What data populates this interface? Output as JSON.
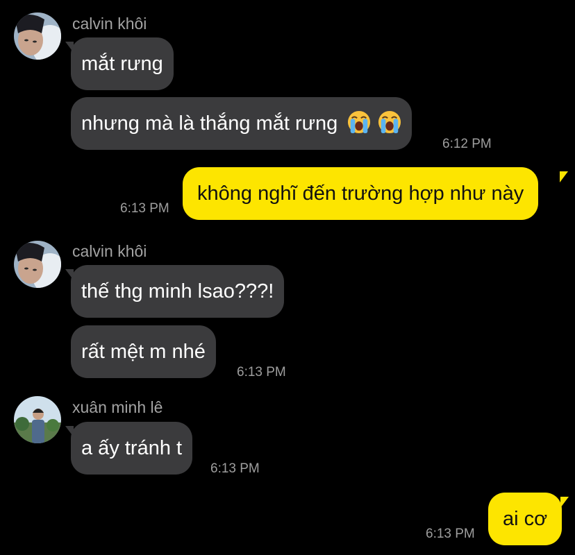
{
  "messages": [
    {
      "sender": "calvin khôi",
      "avatar_icon": "profile-photo-calvin-khoi",
      "bubbles": [
        "mắt rưng",
        "nhưng mà là thắng mắt rưng"
      ],
      "emoji": [
        "loudly-crying-face-emoji",
        "loudly-crying-face-emoji"
      ],
      "time": "6:12 PM"
    },
    {
      "from_me": true,
      "bubbles": [
        "không nghĩ đến trường hợp như này"
      ],
      "time": "6:13 PM"
    },
    {
      "sender": "calvin khôi",
      "avatar_icon": "profile-photo-calvin-khoi",
      "bubbles": [
        "thế thg minh lsao???!",
        "rất mệt m nhé"
      ],
      "time": "6:13 PM"
    },
    {
      "sender": "xuân minh lê",
      "avatar_icon": "profile-photo-xuan-minh-le",
      "bubbles": [
        "a ấy tránh t"
      ],
      "time": "6:13 PM"
    },
    {
      "from_me": true,
      "bubbles": [
        "ai cơ"
      ],
      "time": "6:13 PM"
    }
  ],
  "colors": {
    "background": "#000000",
    "incoming_bubble": "#3b3b3d",
    "outgoing_bubble": "#fde500",
    "sender_name": "#a3a3a3",
    "timestamp": "#9e9e9e"
  }
}
